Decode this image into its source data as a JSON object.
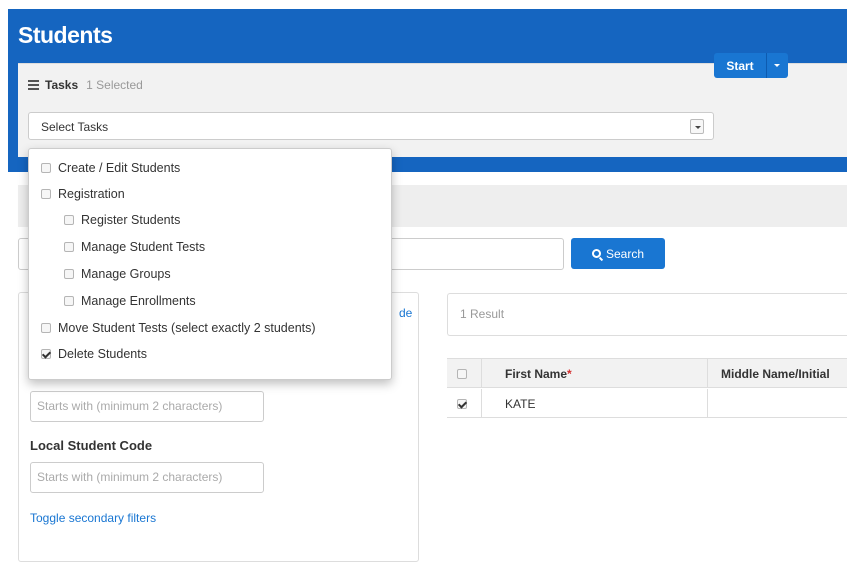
{
  "page": {
    "title": "Students"
  },
  "tasks": {
    "label": "Tasks",
    "selected_count": "1 Selected",
    "select_value": "Select Tasks",
    "start_label": "Start",
    "dropdown_items": [
      {
        "label": "Create / Edit Students",
        "checked": false,
        "indent": 0
      },
      {
        "label": "Registration",
        "checked": false,
        "indent": 0
      },
      {
        "label": "Register Students",
        "checked": false,
        "indent": 1
      },
      {
        "label": "Manage Student Tests",
        "checked": false,
        "indent": 1
      },
      {
        "label": "Manage Groups",
        "checked": false,
        "indent": 1
      },
      {
        "label": "Manage Enrollments",
        "checked": false,
        "indent": 1
      },
      {
        "label": "Move Student Tests (select exactly 2 students)",
        "checked": false,
        "indent": 0
      },
      {
        "label": "Delete Students",
        "checked": true,
        "indent": 0
      }
    ]
  },
  "search": {
    "button_label": "Search"
  },
  "filters": {
    "partial_link": "de",
    "field1_placeholder": "Starts with (minimum 2 characters)",
    "local_code_label": "Local Student Code",
    "field2_placeholder": "Starts with (minimum 2 characters)",
    "toggle_label": "Toggle secondary filters"
  },
  "results": {
    "count_text": "1 Result",
    "columns": [
      "First Name",
      "Middle Name/Initial"
    ],
    "required_marker": "*",
    "rows": [
      {
        "checked": true,
        "first_name": "KATE"
      }
    ]
  },
  "colors": {
    "header": "#1565c0",
    "primary": "#1976d2",
    "link": "#1976d2"
  }
}
